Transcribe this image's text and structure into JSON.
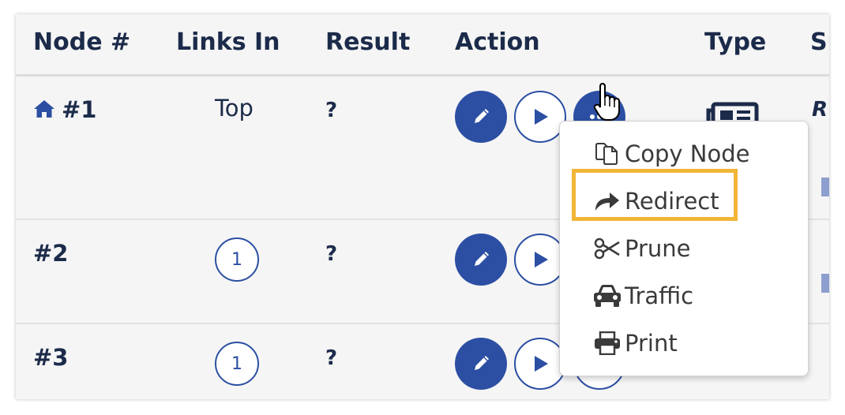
{
  "table": {
    "columns": [
      "Node #",
      "Links In",
      "Result",
      "Action",
      "Type",
      "Su"
    ],
    "rows": [
      {
        "id": "#1",
        "links_in": "Top",
        "result": "?",
        "sub": "R"
      },
      {
        "id": "#2",
        "links_in": "1",
        "result": "?"
      },
      {
        "id": "#3",
        "links_in": "1",
        "result": "?"
      }
    ]
  },
  "menu": {
    "items": [
      {
        "label": "Copy Node",
        "icon": "copy-icon"
      },
      {
        "label": "Redirect",
        "icon": "share-arrow-icon"
      },
      {
        "label": "Prune",
        "icon": "scissors-icon"
      },
      {
        "label": "Traffic",
        "icon": "car-icon"
      },
      {
        "label": "Print",
        "icon": "printer-icon"
      }
    ],
    "highlighted": "Redirect"
  },
  "icons": {
    "home": "home-icon",
    "edit": "pencil-icon",
    "test": "play-icon",
    "more": "ellipsis-icon",
    "type": "newspaper-icon",
    "cursor": "hand-pointer-cursor-icon"
  },
  "colors": {
    "primary": "#2c4fa3",
    "text": "#1c2b4a",
    "highlight": "#f1b637"
  }
}
